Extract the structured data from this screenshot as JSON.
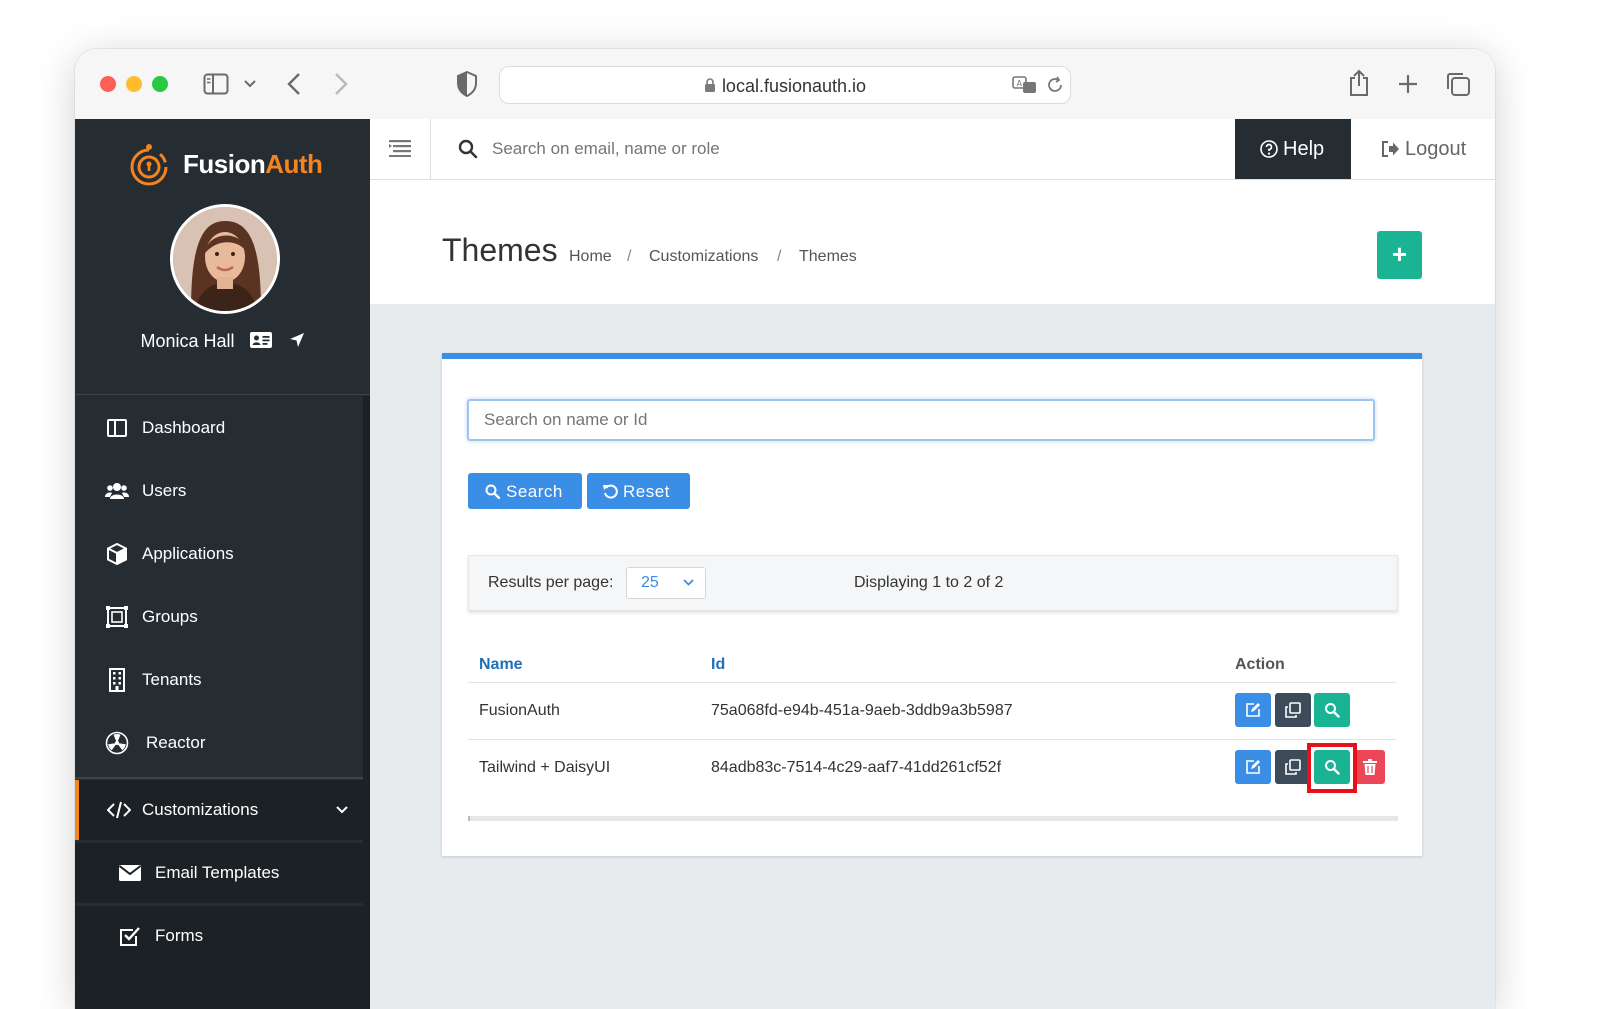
{
  "browser": {
    "url": "local.fusionauth.io"
  },
  "sidebar": {
    "brand_prefix": "Fusion",
    "brand_suffix": "Auth",
    "user_name": "Monica Hall",
    "items": [
      {
        "label": "Dashboard",
        "icon": "dashboard-icon"
      },
      {
        "label": "Users",
        "icon": "users-icon"
      },
      {
        "label": "Applications",
        "icon": "cube-icon"
      },
      {
        "label": "Groups",
        "icon": "groups-icon"
      },
      {
        "label": "Tenants",
        "icon": "building-icon"
      },
      {
        "label": "Reactor",
        "icon": "radiation-icon"
      },
      {
        "label": "Customizations",
        "icon": "code-icon",
        "active": true
      },
      {
        "label": "Email Templates",
        "icon": "envelope-icon"
      },
      {
        "label": "Forms",
        "icon": "checkbox-icon"
      }
    ]
  },
  "topbar": {
    "search_placeholder": "Search on email, name or role",
    "help_label": "Help",
    "logout_label": "Logout"
  },
  "page": {
    "title": "Themes",
    "breadcrumbs": [
      "Home",
      "Customizations",
      "Themes"
    ],
    "add_label": "+"
  },
  "panel": {
    "search_placeholder": "Search on name or Id",
    "search_button": "Search",
    "reset_button": "Reset",
    "results_per_page_label": "Results per page:",
    "results_per_page_value": "25",
    "displaying": "Displaying 1 to 2 of 2",
    "columns": [
      "Name",
      "Id",
      "Action"
    ],
    "rows": [
      {
        "name": "FusionAuth",
        "id": "75a068fd-e94b-451a-9aeb-3ddb9a3b5987"
      },
      {
        "name": "Tailwind + DaisyUI",
        "id": "84adb83c-7514-4c29-aaf7-41dd261cf52f"
      }
    ]
  },
  "colors": {
    "sidebar_bg": "#252d33",
    "accent_orange": "#f58320",
    "primary_blue": "#3a8ee6",
    "success_green": "#1ab394",
    "danger_red": "#ec4758",
    "highlight_red": "#e8101b"
  }
}
